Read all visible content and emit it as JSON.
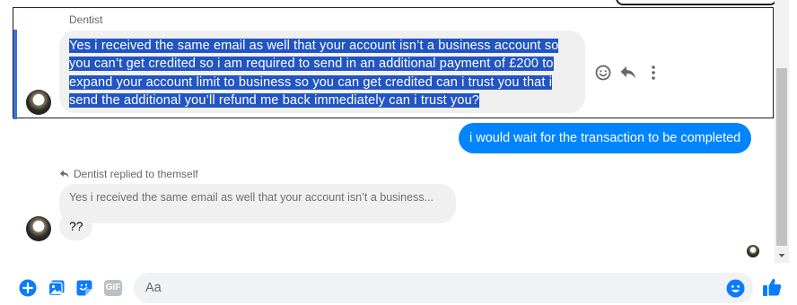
{
  "thread": {
    "focused_message": {
      "sender": "Dentist",
      "text": "Yes i received the same email as well that your account isn’t a business account so you can’t get credited so i am required to send in an additional payment of £200 to expand your account limit to business so you can get credited can i trust you that i send the additional you’ll refund me back immediately can i trust you?"
    },
    "outgoing_message": {
      "text": "i would wait for the transaction to be completed"
    },
    "reply": {
      "label": "Dentist replied to themself",
      "quoted_text": "Yes i received the same email as well that your account isn’t a business...",
      "text": "??"
    }
  },
  "composer": {
    "placeholder": "Aa",
    "gif_label": "GIF"
  },
  "colors": {
    "messenger_blue": "#0084ff",
    "icon_blue": "#0a7cff",
    "bubble_gray": "#f0f0f0",
    "selection": "#2255c3"
  },
  "icons": {
    "actions": [
      "smile-icon",
      "reply-icon",
      "more-icon"
    ],
    "composer": [
      "plus-icon",
      "photo-icon",
      "sticker-icon",
      "gif-icon",
      "emoji-icon",
      "thumbs-up-icon"
    ]
  }
}
